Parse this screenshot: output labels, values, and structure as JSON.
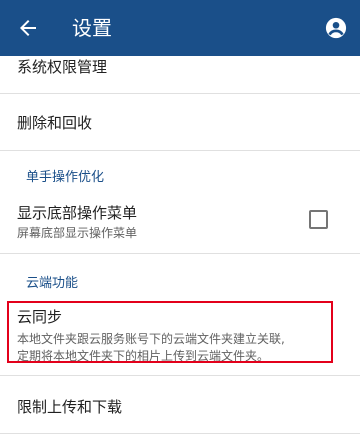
{
  "appbar": {
    "title": "设置",
    "back_icon": "arrow-back-icon",
    "account_icon": "account-circle-icon",
    "background": "#1a4f89"
  },
  "items": {
    "permissions": {
      "title": "系统权限管理"
    },
    "delete": {
      "title": "删除和回收"
    },
    "section_one_handed": "单手操作优化",
    "bottom_menu": {
      "title": "显示底部操作菜单",
      "subtitle": "屏幕底部显示操作菜单",
      "checked": false
    },
    "section_cloud": "云端功能",
    "cloud_sync": {
      "title": "云同步",
      "subtitle_line1": "本地文件夹跟云服务账号下的云端文件夹建立关联,",
      "subtitle_line2": "定期将本地文件夹下的相片上传到云端文件夹。"
    },
    "limit_transfer": {
      "title": "限制上传和下载"
    }
  },
  "colors": {
    "accent": "#1a4f89",
    "highlight": "#e3001b"
  }
}
